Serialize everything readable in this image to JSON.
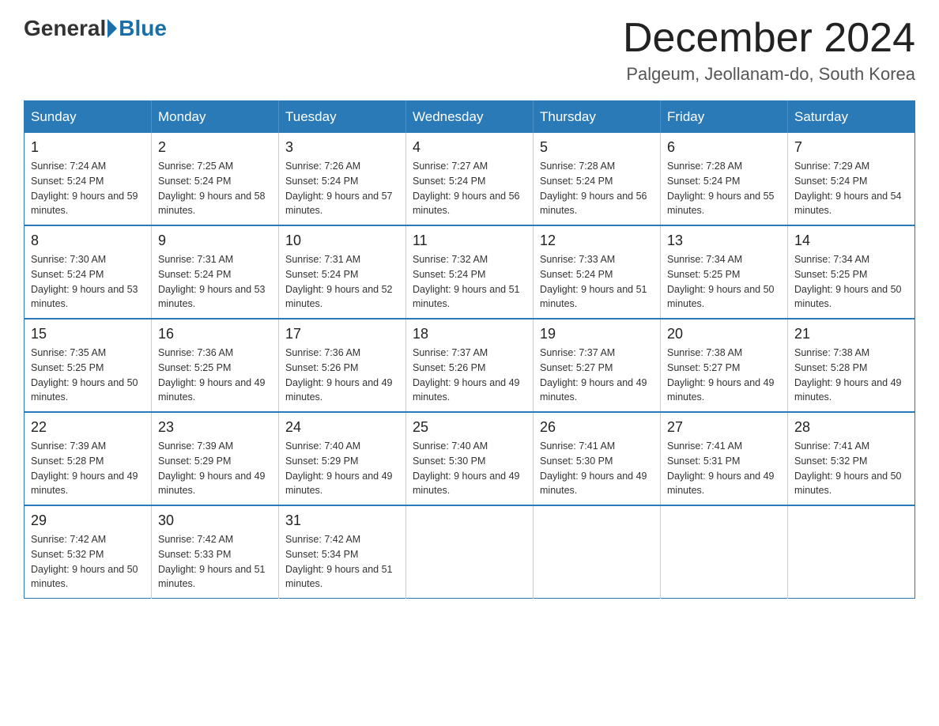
{
  "header": {
    "logo_general": "General",
    "logo_blue": "Blue",
    "main_title": "December 2024",
    "subtitle": "Palgeum, Jeollanam-do, South Korea"
  },
  "days_of_week": [
    "Sunday",
    "Monday",
    "Tuesday",
    "Wednesday",
    "Thursday",
    "Friday",
    "Saturday"
  ],
  "weeks": [
    [
      {
        "day": "1",
        "sunrise": "7:24 AM",
        "sunset": "5:24 PM",
        "daylight": "9 hours and 59 minutes."
      },
      {
        "day": "2",
        "sunrise": "7:25 AM",
        "sunset": "5:24 PM",
        "daylight": "9 hours and 58 minutes."
      },
      {
        "day": "3",
        "sunrise": "7:26 AM",
        "sunset": "5:24 PM",
        "daylight": "9 hours and 57 minutes."
      },
      {
        "day": "4",
        "sunrise": "7:27 AM",
        "sunset": "5:24 PM",
        "daylight": "9 hours and 56 minutes."
      },
      {
        "day": "5",
        "sunrise": "7:28 AM",
        "sunset": "5:24 PM",
        "daylight": "9 hours and 56 minutes."
      },
      {
        "day": "6",
        "sunrise": "7:28 AM",
        "sunset": "5:24 PM",
        "daylight": "9 hours and 55 minutes."
      },
      {
        "day": "7",
        "sunrise": "7:29 AM",
        "sunset": "5:24 PM",
        "daylight": "9 hours and 54 minutes."
      }
    ],
    [
      {
        "day": "8",
        "sunrise": "7:30 AM",
        "sunset": "5:24 PM",
        "daylight": "9 hours and 53 minutes."
      },
      {
        "day": "9",
        "sunrise": "7:31 AM",
        "sunset": "5:24 PM",
        "daylight": "9 hours and 53 minutes."
      },
      {
        "day": "10",
        "sunrise": "7:31 AM",
        "sunset": "5:24 PM",
        "daylight": "9 hours and 52 minutes."
      },
      {
        "day": "11",
        "sunrise": "7:32 AM",
        "sunset": "5:24 PM",
        "daylight": "9 hours and 51 minutes."
      },
      {
        "day": "12",
        "sunrise": "7:33 AM",
        "sunset": "5:24 PM",
        "daylight": "9 hours and 51 minutes."
      },
      {
        "day": "13",
        "sunrise": "7:34 AM",
        "sunset": "5:25 PM",
        "daylight": "9 hours and 50 minutes."
      },
      {
        "day": "14",
        "sunrise": "7:34 AM",
        "sunset": "5:25 PM",
        "daylight": "9 hours and 50 minutes."
      }
    ],
    [
      {
        "day": "15",
        "sunrise": "7:35 AM",
        "sunset": "5:25 PM",
        "daylight": "9 hours and 50 minutes."
      },
      {
        "day": "16",
        "sunrise": "7:36 AM",
        "sunset": "5:25 PM",
        "daylight": "9 hours and 49 minutes."
      },
      {
        "day": "17",
        "sunrise": "7:36 AM",
        "sunset": "5:26 PM",
        "daylight": "9 hours and 49 minutes."
      },
      {
        "day": "18",
        "sunrise": "7:37 AM",
        "sunset": "5:26 PM",
        "daylight": "9 hours and 49 minutes."
      },
      {
        "day": "19",
        "sunrise": "7:37 AM",
        "sunset": "5:27 PM",
        "daylight": "9 hours and 49 minutes."
      },
      {
        "day": "20",
        "sunrise": "7:38 AM",
        "sunset": "5:27 PM",
        "daylight": "9 hours and 49 minutes."
      },
      {
        "day": "21",
        "sunrise": "7:38 AM",
        "sunset": "5:28 PM",
        "daylight": "9 hours and 49 minutes."
      }
    ],
    [
      {
        "day": "22",
        "sunrise": "7:39 AM",
        "sunset": "5:28 PM",
        "daylight": "9 hours and 49 minutes."
      },
      {
        "day": "23",
        "sunrise": "7:39 AM",
        "sunset": "5:29 PM",
        "daylight": "9 hours and 49 minutes."
      },
      {
        "day": "24",
        "sunrise": "7:40 AM",
        "sunset": "5:29 PM",
        "daylight": "9 hours and 49 minutes."
      },
      {
        "day": "25",
        "sunrise": "7:40 AM",
        "sunset": "5:30 PM",
        "daylight": "9 hours and 49 minutes."
      },
      {
        "day": "26",
        "sunrise": "7:41 AM",
        "sunset": "5:30 PM",
        "daylight": "9 hours and 49 minutes."
      },
      {
        "day": "27",
        "sunrise": "7:41 AM",
        "sunset": "5:31 PM",
        "daylight": "9 hours and 49 minutes."
      },
      {
        "day": "28",
        "sunrise": "7:41 AM",
        "sunset": "5:32 PM",
        "daylight": "9 hours and 50 minutes."
      }
    ],
    [
      {
        "day": "29",
        "sunrise": "7:42 AM",
        "sunset": "5:32 PM",
        "daylight": "9 hours and 50 minutes."
      },
      {
        "day": "30",
        "sunrise": "7:42 AM",
        "sunset": "5:33 PM",
        "daylight": "9 hours and 51 minutes."
      },
      {
        "day": "31",
        "sunrise": "7:42 AM",
        "sunset": "5:34 PM",
        "daylight": "9 hours and 51 minutes."
      },
      null,
      null,
      null,
      null
    ]
  ]
}
